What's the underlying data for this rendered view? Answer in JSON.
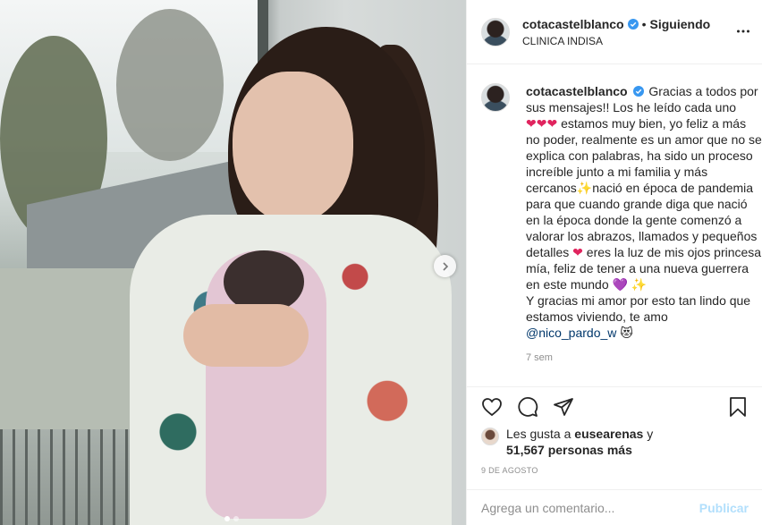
{
  "post": {
    "username": "cotacastelblanco",
    "separator": "•",
    "follow_status": "Siguiendo",
    "location": "CLINICA INDISA",
    "caption": {
      "username": "cotacastelblanco",
      "part1": "Gracias a todos por sus mensajes!! Los he leído cada uno ",
      "hearts": "❤❤❤",
      "part2": " estamos muy bien, yo feliz a más no poder, realmente es un amor que no se explica con palabras, ha sido un proceso increíble junto a mi familia y más cercanos",
      "sparkle1": "✨",
      "part3": "nació en época de pandemia para que cuando grande diga que nació en la época donde la gente comenzó a valorar los abrazos, llamados y pequeños detalles ",
      "heart2": "❤",
      "part4": " eres la luz de mis ojos princesa mía, feliz de tener a una nueva guerrera en este mundo ",
      "purple_heart": "💜",
      "sparkle2": "✨",
      "part5": "Y gracias mi amor por esto tan lindo que estamos viviendo, te amo",
      "mention": "@nico_pardo_w",
      "emoji_end": "😻",
      "time_ago": "7 sem"
    },
    "likes": {
      "prefix": "Les gusta a",
      "liker": "eusearenas",
      "conjunction": "y",
      "count": "51,567 personas más"
    },
    "date": "9 DE AGOSTO",
    "comment_placeholder": "Agrega un comentario...",
    "publish_label": "Publicar",
    "carousel": {
      "total": 2,
      "active": 1
    },
    "colors": {
      "verified": "#3897f0",
      "heart": "#e0245e",
      "link": "#00376b",
      "publish_disabled": "#b2dffc",
      "muted": "#8e8e8e"
    },
    "icons": [
      "verified-badge-icon",
      "more-options-icon",
      "heart-icon",
      "comment-icon",
      "share-icon",
      "bookmark-icon",
      "chevron-right-icon"
    ]
  }
}
